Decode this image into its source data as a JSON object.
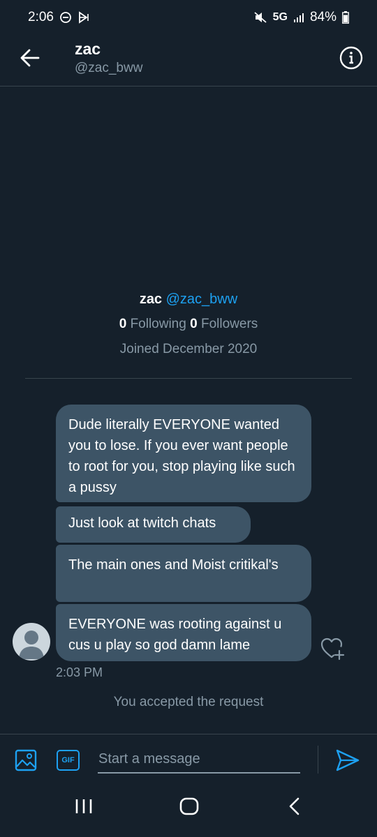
{
  "status_bar": {
    "time": "2:06",
    "network": "5G",
    "battery": "84%",
    "icons": [
      "do-not-disturb-icon",
      "sound-icon",
      "mute-icon",
      "signal-icon",
      "battery-icon"
    ]
  },
  "header": {
    "name": "zac",
    "handle": "@zac_bww",
    "back_icon": "arrow-left-icon",
    "info_icon": "info-icon"
  },
  "profile": {
    "name": "zac",
    "handle": "@zac_bww",
    "following_count": "0",
    "following_label": "Following",
    "followers_count": "0",
    "followers_label": "Followers",
    "joined": "Joined December 2020"
  },
  "messages": [
    {
      "text": "Dude literally EVERYONE wanted you to lose. If you ever want people to root for you, stop playing like such a pussy"
    },
    {
      "text": "Just look at twitch chats"
    },
    {
      "text": "The main ones and Moist critikal's"
    },
    {
      "text": "EVERYONE was rooting against u cus u play so god damn lame"
    }
  ],
  "message_time": "2:03 PM",
  "system_message": "You accepted the request",
  "composer": {
    "placeholder": "Start a message",
    "gif_label": "GIF",
    "media_icon": "image-icon",
    "send_icon": "send-icon"
  },
  "colors": {
    "background": "#15202b",
    "bubble": "#3d5466",
    "accent": "#1da1f2",
    "muted": "#8899a6"
  }
}
